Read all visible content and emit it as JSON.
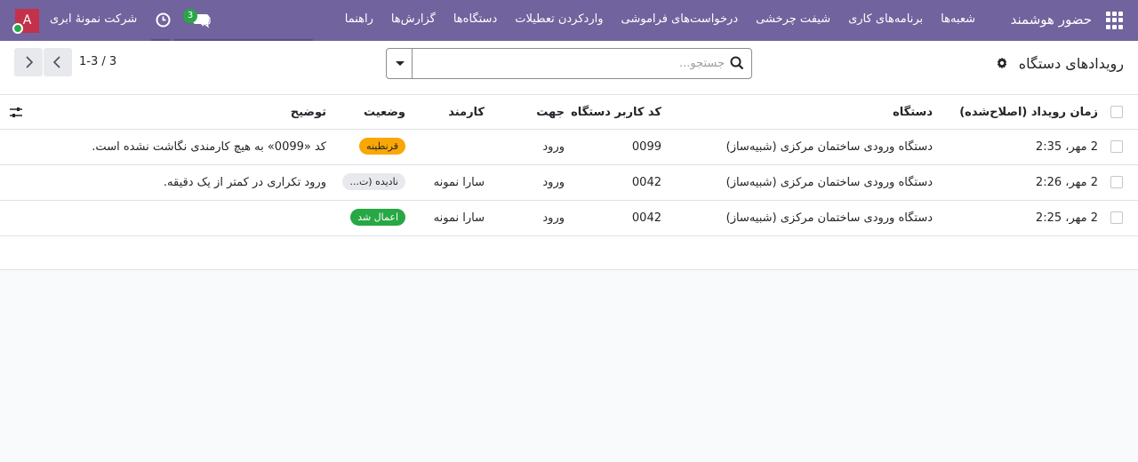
{
  "navbar": {
    "brand": "حضور هوشمند",
    "menu": [
      "شعبه‌ها",
      "برنامه‌های کاری",
      "شیفت چرخشی",
      "درخواست‌های فراموشی",
      "واردکردن تعطیلات",
      "دستگاه‌ها",
      "گزارش‌ها",
      "راهنما"
    ],
    "chat_count": "3",
    "company": "شرکت نمونهٔ ابری",
    "avatar_letter": "A"
  },
  "control": {
    "title": "رویدادهای دستگاه",
    "search_placeholder": "جستجو...",
    "pager": "1-3 / 3"
  },
  "table": {
    "headers": {
      "time": "زمان رویداد (اصلاح‌شده)",
      "device": "دستگاه",
      "code": "کد کاربر دستگاه",
      "direction": "جهت",
      "employee": "کارمند",
      "status": "وضعیت",
      "description": "توضیح"
    },
    "rows": [
      {
        "time": "2 مهر، 2:35",
        "device": "دستگاه ورودی ساختمان مرکزی (شبیه‌ساز)",
        "code": "0099",
        "direction": "ورود",
        "employee": "",
        "status": "قرنطینه",
        "status_color": "#f9a705",
        "description": "کد «0099» به هیچ کارمندی نگاشت نشده است."
      },
      {
        "time": "2 مهر، 2:26",
        "device": "دستگاه ورودی ساختمان مرکزی (شبیه‌ساز)",
        "code": "0042",
        "direction": "ورود",
        "employee": "سارا نمونه",
        "status": "نادیده (ت...",
        "status_color": "#e7e9ed",
        "description": "ورود تکراری در کمتر از یک دقیقه."
      },
      {
        "time": "2 مهر، 2:25",
        "device": "دستگاه ورودی ساختمان مرکزی (شبیه‌ساز)",
        "code": "0042",
        "direction": "ورود",
        "employee": "سارا نمونه",
        "status": "اعمال شد",
        "status_color": "#28a745",
        "description": ""
      }
    ]
  },
  "colors": {
    "navbar": "#71639e",
    "quarantine": "#f9a705",
    "applied": "#28a745",
    "ignored": "#e7e9ed"
  }
}
